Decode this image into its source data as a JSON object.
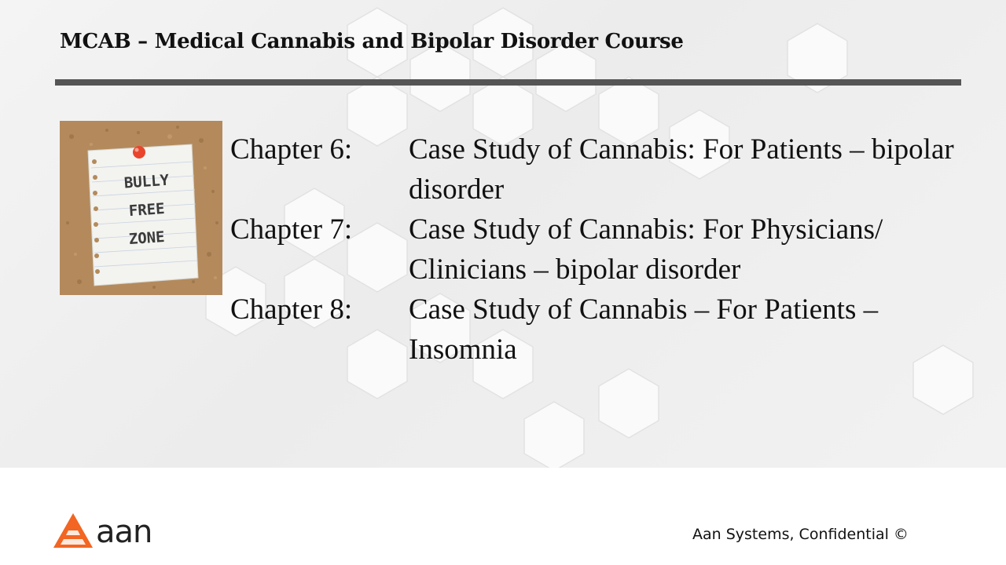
{
  "slide": {
    "title": "MCAB – Medical Cannabis and Bipolar Disorder Course"
  },
  "image": {
    "note_lines": [
      "BULLY",
      "FREE",
      "ZONE"
    ]
  },
  "chapters": [
    {
      "label": "Chapter 6:",
      "text": "Case Study of Cannabis: For Patients – bipolar disorder"
    },
    {
      "label": "Chapter 7:",
      "text": "Case Study of Cannabis: For Physicians/ Clinicians – bipolar disorder"
    },
    {
      "label": "Chapter 8:",
      "text": "Case Study of Cannabis – For Patients – Insomnia"
    }
  ],
  "logo": {
    "word": "aan",
    "color": "#F26522"
  },
  "footer": {
    "text": "Aan Systems, Confidential ©"
  }
}
